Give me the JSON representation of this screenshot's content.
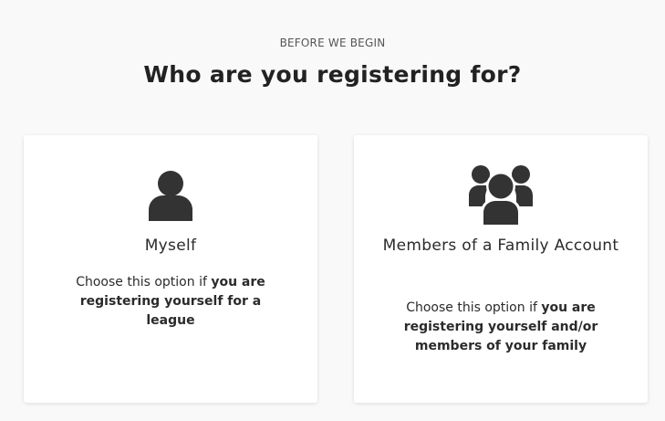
{
  "header": {
    "eyebrow": "BEFORE WE BEGIN",
    "title": "Who are you registering for?"
  },
  "options": [
    {
      "icon": "person-icon",
      "title": "Myself",
      "desc_prefix": "Choose this option if ",
      "desc_bold": "you are registering yourself for a league"
    },
    {
      "icon": "group-icon",
      "title": "Members of a Family Account",
      "desc_prefix": "Choose this option if ",
      "desc_bold": "you are registering yourself and/or members of your family"
    }
  ],
  "colors": {
    "background": "#f9f9f9",
    "card": "#ffffff",
    "icon": "#333333",
    "text": "#2b2b2b"
  }
}
